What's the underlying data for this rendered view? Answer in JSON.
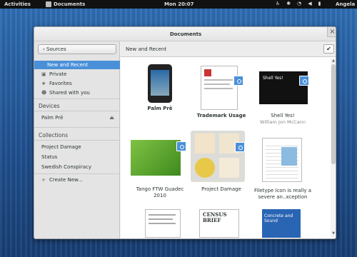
{
  "topbar": {
    "activities": "Activities",
    "app_name": "Documents",
    "clock": "Mon 20:07",
    "user": "Angela"
  },
  "window": {
    "title": "Documents",
    "close_glyph": "×"
  },
  "sidebar": {
    "sources_button": "Sources",
    "items": [
      {
        "label": "New and Recent",
        "selected": true
      },
      {
        "label": "Private",
        "icon": "lock-icon"
      },
      {
        "label": "Favorites",
        "icon": "star-icon"
      },
      {
        "label": "Shared with you",
        "icon": "people-icon"
      }
    ],
    "devices_header": "Devices",
    "devices": [
      {
        "label": "Palm Prē",
        "icon": "eject-icon"
      }
    ],
    "collections_header": "Collections",
    "collections": [
      {
        "label": "Project Damage"
      },
      {
        "label": "Status"
      },
      {
        "label": "Swedish Conspiracy"
      }
    ],
    "create_new": "Create New..."
  },
  "content": {
    "header": "New and Recent",
    "tiles": [
      {
        "title": "Palm Prē",
        "bold": true
      },
      {
        "title": "Trademark Usage",
        "bold": true,
        "shared": true
      },
      {
        "title": "Shell Yes!",
        "subtitle": "William Jon McCann",
        "shared": true,
        "slide_title": "Shell Yes!"
      },
      {
        "title": "Tango FTW Guadec 2010",
        "shared": true
      },
      {
        "title": "Project Damage",
        "shared": true
      },
      {
        "title": "Filetype Icon is really a severe an..xception"
      },
      {
        "title": ""
      },
      {
        "title": "",
        "label": "CENSUS BRIEF"
      },
      {
        "title": "",
        "label": "Concrete and Sound"
      }
    ]
  },
  "colors": {
    "accent": "#4a90d9",
    "shell_bar": "#111111"
  }
}
